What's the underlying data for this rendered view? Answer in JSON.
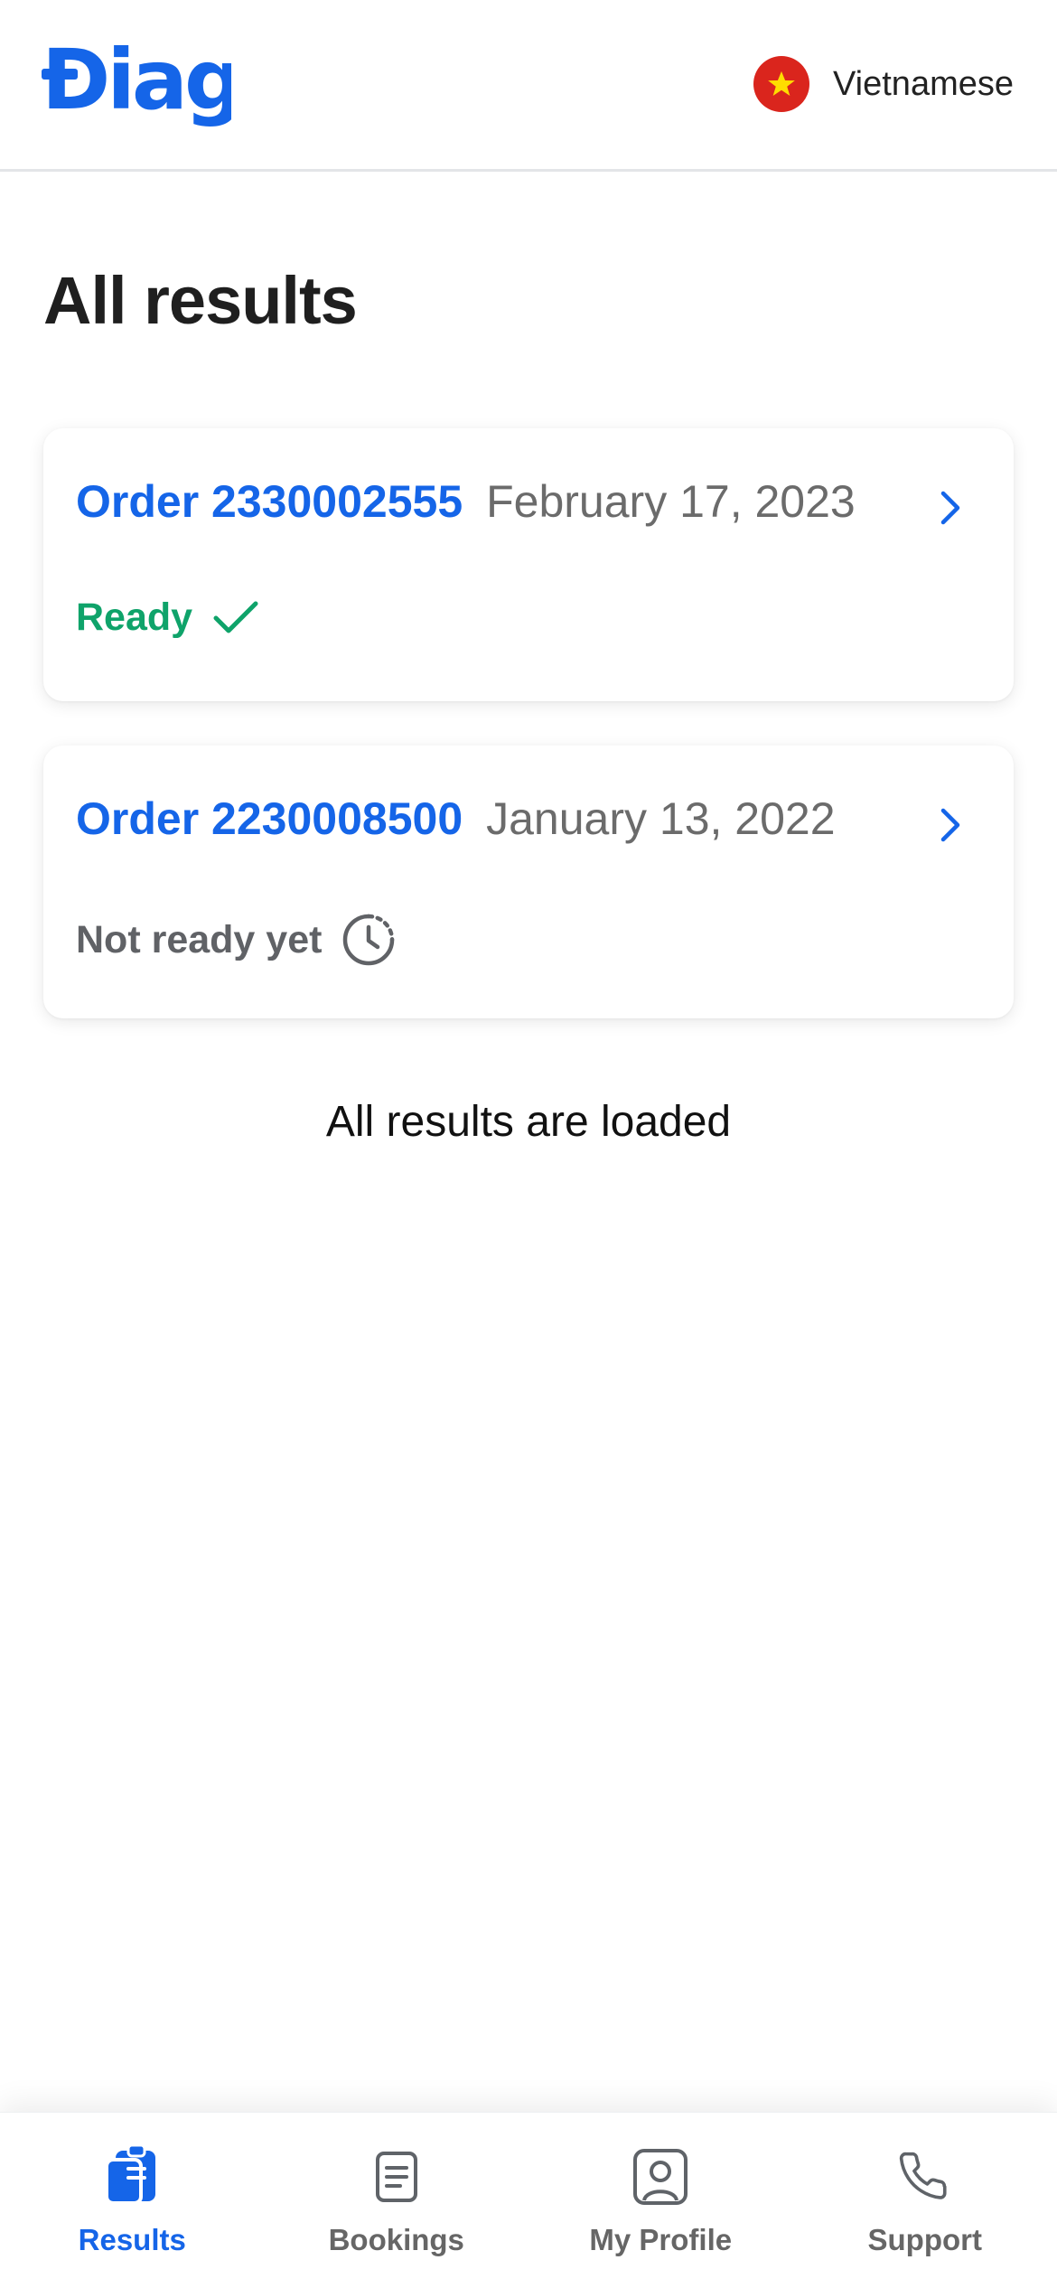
{
  "header": {
    "logo_text": "Diag",
    "language_label": "Vietnamese"
  },
  "page": {
    "title": "All results"
  },
  "orders": [
    {
      "label": "Order 2330002555",
      "date": "February 17, 2023",
      "status": "Ready",
      "status_icon": "check-icon",
      "status_color": "#0fa36a"
    },
    {
      "label": "Order 2230008500",
      "date": "January 13, 2022",
      "status": "Not ready yet",
      "status_icon": "clock-pending-icon",
      "status_color": "#606266"
    }
  ],
  "footer_message": "All results are loaded",
  "tabs": [
    {
      "label": "Results",
      "icon": "clipboard-icon",
      "active": true
    },
    {
      "label": "Bookings",
      "icon": "document-icon",
      "active": false
    },
    {
      "label": "My Profile",
      "icon": "profile-icon",
      "active": false
    },
    {
      "label": "Support",
      "icon": "phone-icon",
      "active": false
    }
  ],
  "colors": {
    "accent": "#1565e8",
    "ready": "#0fa36a",
    "muted": "#6b6b6b",
    "flag_red": "#da251d",
    "flag_star": "#ffdd00"
  }
}
